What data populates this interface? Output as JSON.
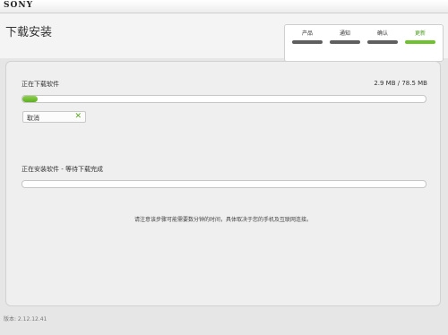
{
  "window": {
    "brand": "SONY"
  },
  "header": {
    "title": "下载安装"
  },
  "steps": [
    {
      "label": "产品",
      "active": false
    },
    {
      "label": "通知",
      "active": false
    },
    {
      "label": "确认",
      "active": false
    },
    {
      "label": "更新",
      "active": true
    }
  ],
  "download": {
    "label": "正在下载软件",
    "size_text": "2.9 MB / 78.5 MB",
    "progress_fraction": 0.037,
    "cancel_label": "取消"
  },
  "install": {
    "label": "正在安装软件 - 等待下载完成",
    "progress_fraction": 0
  },
  "note": "请注意该步骤可能需要数分钟的时间，具体取决于您的手机及互联网连接。",
  "footer": {
    "version": "版本: 2.12.12.41"
  },
  "colors": {
    "accent": "#6ec22d",
    "step_inactive": "#5f5f5f"
  }
}
